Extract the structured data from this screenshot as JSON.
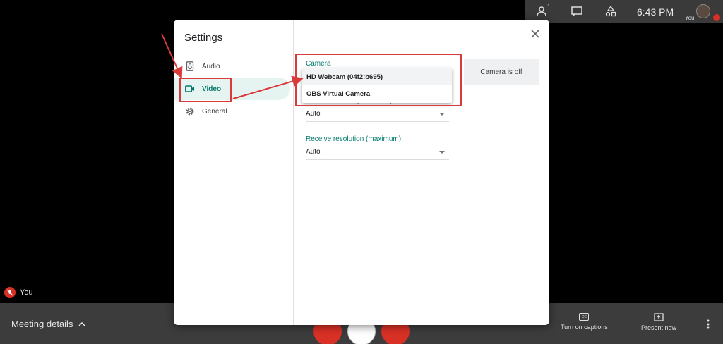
{
  "topbar": {
    "time": "6:43 PM",
    "avatar_label": "You",
    "people_count": "1"
  },
  "self_tile": {
    "label": "You"
  },
  "bottombar": {
    "meeting_details": "Meeting details",
    "captions_label": "Turn on captions",
    "present_label": "Present now",
    "captions_icon_text": "CC"
  },
  "settings": {
    "title": "Settings",
    "nav": [
      {
        "label": "Audio",
        "icon": "speaker-icon"
      },
      {
        "label": "Video",
        "icon": "video-camera-icon"
      },
      {
        "label": "General",
        "icon": "gear-icon"
      }
    ],
    "camera": {
      "label": "Camera",
      "options": [
        "HD Webcam (04f2:b695)",
        "OBS Virtual Camera"
      ],
      "preview_text": "Camera is off"
    },
    "send_resolution": {
      "label": "Send resolution (maximum)",
      "value": "Auto"
    },
    "receive_resolution": {
      "label": "Receive resolution (maximum)",
      "value": "Auto"
    }
  },
  "colors": {
    "accent": "#00796b",
    "annotation": "#d93b3b",
    "danger": "#d93025"
  }
}
